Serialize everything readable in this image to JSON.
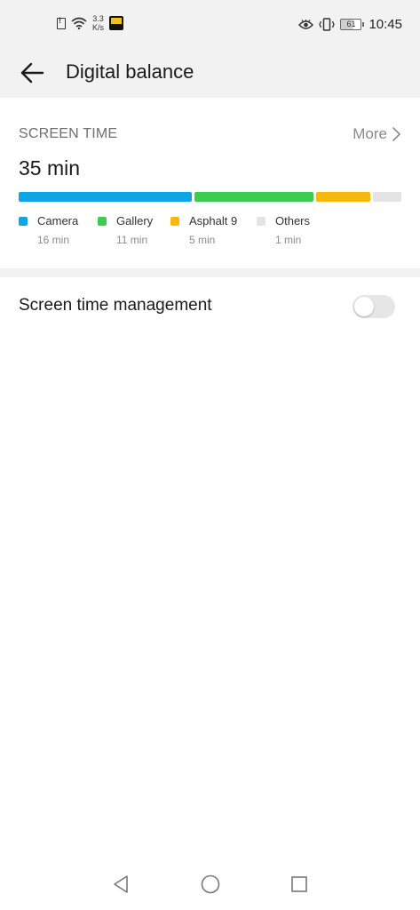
{
  "status_bar": {
    "network_speed_value": "3.3",
    "network_speed_unit": "K/s",
    "battery_level": "61",
    "time": "10:45",
    "icons": [
      "sim-alert-icon",
      "wifi-icon",
      "app-notification-icon",
      "eye-comfort-icon",
      "vibrate-icon",
      "battery-icon"
    ]
  },
  "header": {
    "back_icon": "arrow-left-icon",
    "title": "Digital balance"
  },
  "screen_time": {
    "section_label": "SCREEN TIME",
    "more_label": "More",
    "total": "35 min",
    "apps": [
      {
        "name": "Camera",
        "time": "16 min",
        "minutes": 16,
        "color": "#0ea5e4"
      },
      {
        "name": "Gallery",
        "time": "11 min",
        "minutes": 11,
        "color": "#3ccc4f"
      },
      {
        "name": "Asphalt 9",
        "time": "5 min",
        "minutes": 5,
        "color": "#f5b80f"
      },
      {
        "name": "Others",
        "time": "1 min",
        "minutes": 1,
        "color": "#e4e4e4"
      }
    ]
  },
  "management": {
    "label": "Screen time management",
    "toggle_on": false
  },
  "nav_bar": {
    "icons": [
      "triangle-back-icon",
      "circle-home-icon",
      "square-recents-icon"
    ]
  }
}
